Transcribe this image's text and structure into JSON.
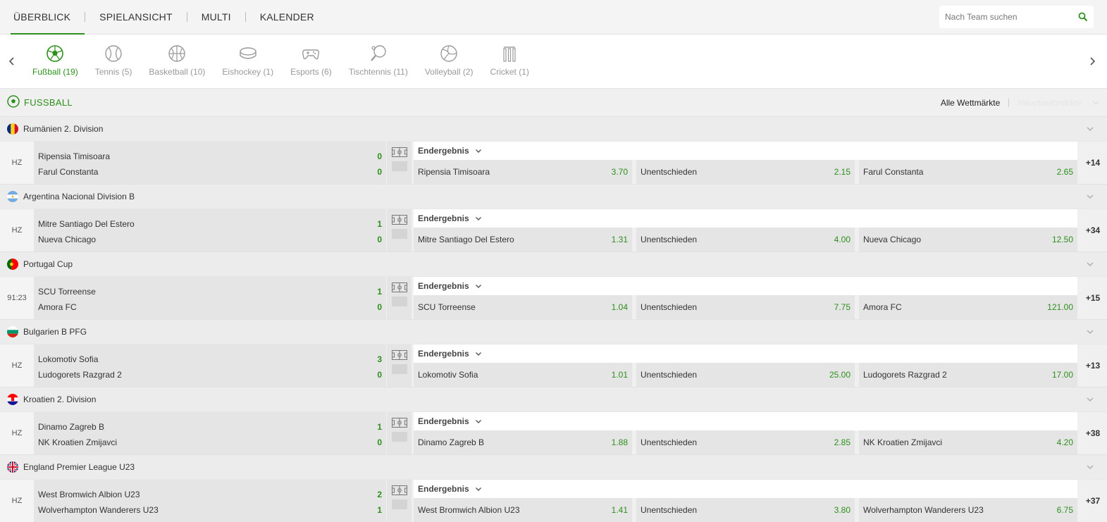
{
  "nav": {
    "tabs": [
      "ÜBERBLICK",
      "SPIELANSICHT",
      "MULTI",
      "KALENDER"
    ],
    "search_placeholder": "Nach Team suchen"
  },
  "sports": [
    {
      "label": "Fußball (19)",
      "icon": "soccer-ball-icon",
      "active": true
    },
    {
      "label": "Tennis (5)",
      "icon": "tennis-ball-icon"
    },
    {
      "label": "Basketball (10)",
      "icon": "basketball-icon"
    },
    {
      "label": "Eishockey (1)",
      "icon": "hockey-puck-icon"
    },
    {
      "label": "Esports (6)",
      "icon": "gamepad-icon"
    },
    {
      "label": "Tischtennis (11)",
      "icon": "table-tennis-icon"
    },
    {
      "label": "Volleyball (2)",
      "icon": "volleyball-icon"
    },
    {
      "label": "Cricket (1)",
      "icon": "cricket-wicket-icon"
    }
  ],
  "section": {
    "title": "FUSSBALL",
    "all_markets": "Alle Wettmärkte",
    "main_markets": "Hauptwettmärkte"
  },
  "colors": {
    "accent": "#2d8f1c"
  },
  "groups": [
    {
      "league": "Rumänien 2. Division",
      "flag": "ro",
      "time": "HZ",
      "home": "Ripensia Timisoara",
      "away": "Farul Constanta",
      "home_score": "0",
      "away_score": "0",
      "market": "Endergebnis",
      "odds": [
        {
          "label": "Ripensia Timisoara",
          "price": "3.70"
        },
        {
          "label": "Unentschieden",
          "price": "2.15"
        },
        {
          "label": "Farul Constanta",
          "price": "2.65"
        }
      ],
      "more": "+14"
    },
    {
      "league": "Argentina Nacional Division B",
      "flag": "ar",
      "time": "HZ",
      "home": "Mitre Santiago Del Estero",
      "away": "Nueva Chicago",
      "home_score": "1",
      "away_score": "0",
      "market": "Endergebnis",
      "odds": [
        {
          "label": "Mitre Santiago Del Estero",
          "price": "1.31"
        },
        {
          "label": "Unentschieden",
          "price": "4.00"
        },
        {
          "label": "Nueva Chicago",
          "price": "12.50"
        }
      ],
      "more": "+34"
    },
    {
      "league": "Portugal Cup",
      "flag": "pt",
      "time": "91:23",
      "home": "SCU Torreense",
      "away": "Amora FC",
      "home_score": "1",
      "away_score": "0",
      "market": "Endergebnis",
      "odds": [
        {
          "label": "SCU Torreense",
          "price": "1.04"
        },
        {
          "label": "Unentschieden",
          "price": "7.75"
        },
        {
          "label": "Amora FC",
          "price": "121.00"
        }
      ],
      "more": "+15"
    },
    {
      "league": "Bulgarien B PFG",
      "flag": "bg",
      "time": "HZ",
      "home": "Lokomotiv Sofia",
      "away": "Ludogorets Razgrad 2",
      "home_score": "3",
      "away_score": "0",
      "market": "Endergebnis",
      "odds": [
        {
          "label": "Lokomotiv Sofia",
          "price": "1.01"
        },
        {
          "label": "Unentschieden",
          "price": "25.00"
        },
        {
          "label": "Ludogorets Razgrad 2",
          "price": "17.00"
        }
      ],
      "more": "+13"
    },
    {
      "league": "Kroatien 2. Division",
      "flag": "hr",
      "time": "HZ",
      "home": "Dinamo Zagreb B",
      "away": "NK Kroatien Zmijavci",
      "home_score": "1",
      "away_score": "0",
      "market": "Endergebnis",
      "odds": [
        {
          "label": "Dinamo Zagreb B",
          "price": "1.88"
        },
        {
          "label": "Unentschieden",
          "price": "2.85"
        },
        {
          "label": "NK Kroatien Zmijavci",
          "price": "4.20"
        }
      ],
      "more": "+38"
    },
    {
      "league": "England Premier League U23",
      "flag": "gb",
      "time": "HZ",
      "home": "West Bromwich Albion U23",
      "away": "Wolverhampton Wanderers U23",
      "home_score": "2",
      "away_score": "1",
      "market": "Endergebnis",
      "odds": [
        {
          "label": "West Bromwich Albion U23",
          "price": "1.41"
        },
        {
          "label": "Unentschieden",
          "price": "3.80"
        },
        {
          "label": "Wolverhampton Wanderers U23",
          "price": "6.75"
        }
      ],
      "more": "+37"
    }
  ]
}
